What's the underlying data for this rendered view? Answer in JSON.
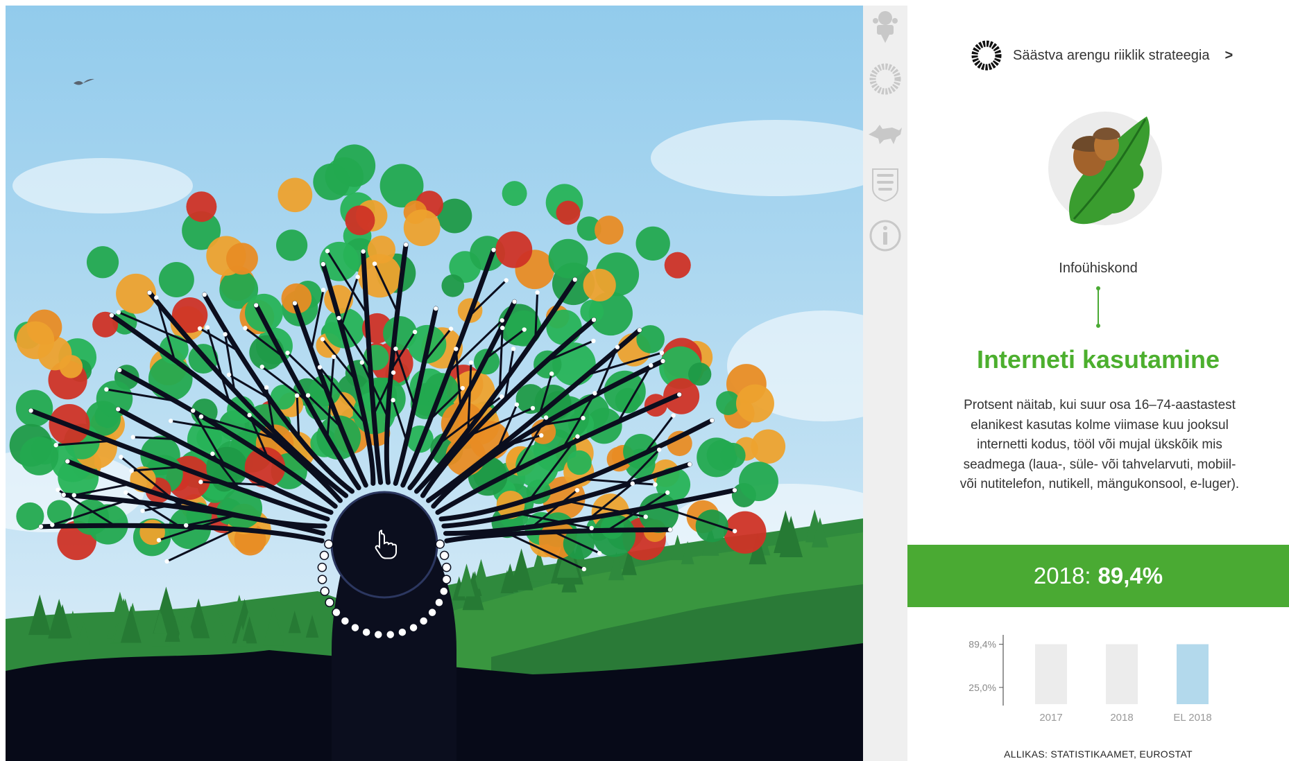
{
  "sidebar": {
    "icons": [
      {
        "name": "coat-of-arms-icon"
      },
      {
        "name": "strategy-ring-icon"
      },
      {
        "name": "wolf-icon"
      },
      {
        "name": "estonian-lions-icon"
      },
      {
        "name": "info-icon"
      }
    ]
  },
  "panel": {
    "strategy_link": "Säästva arengu riiklik strateegia",
    "strategy_chevron": ">",
    "category": "Infoühiskond",
    "indicator_title": "Interneti kasutamine",
    "description": "Protsent näitab, kui suur osa 16–74-aastastest elanikest kasutas kolme viimase kuu jooksul internetti kodus, tööl või mujal ükskõik mis seadmega (laua-, süle- või tahvelarvuti, mobiil- või nutitelefon, nutikell, mängukonsool, e-luger).",
    "value_year": "2018:",
    "value": "89,4%",
    "source": "ALLIKAS: STATISTIKAAMET, EUROSTAT"
  },
  "colors": {
    "accent_green": "#4aaa33",
    "title_green": "#4caf2e",
    "leaf_green": "#23a94f",
    "leaf_orange": "#eda22e",
    "leaf_red": "#cf3326",
    "trunk": "#0b0e1e",
    "sky": "#a6d3ee",
    "eu_bar": "#b3d9ec",
    "bar_grey": "#ececec"
  },
  "chart_data": {
    "type": "bar",
    "categories": [
      "2017",
      "2018",
      "EL 2018"
    ],
    "y_ticks": [
      "89,4%",
      "25,0%"
    ],
    "values": [
      89.4,
      89.4,
      89.4
    ],
    "bar_colors": [
      "#ececec",
      "#ececec",
      "#b3d9ec"
    ]
  }
}
